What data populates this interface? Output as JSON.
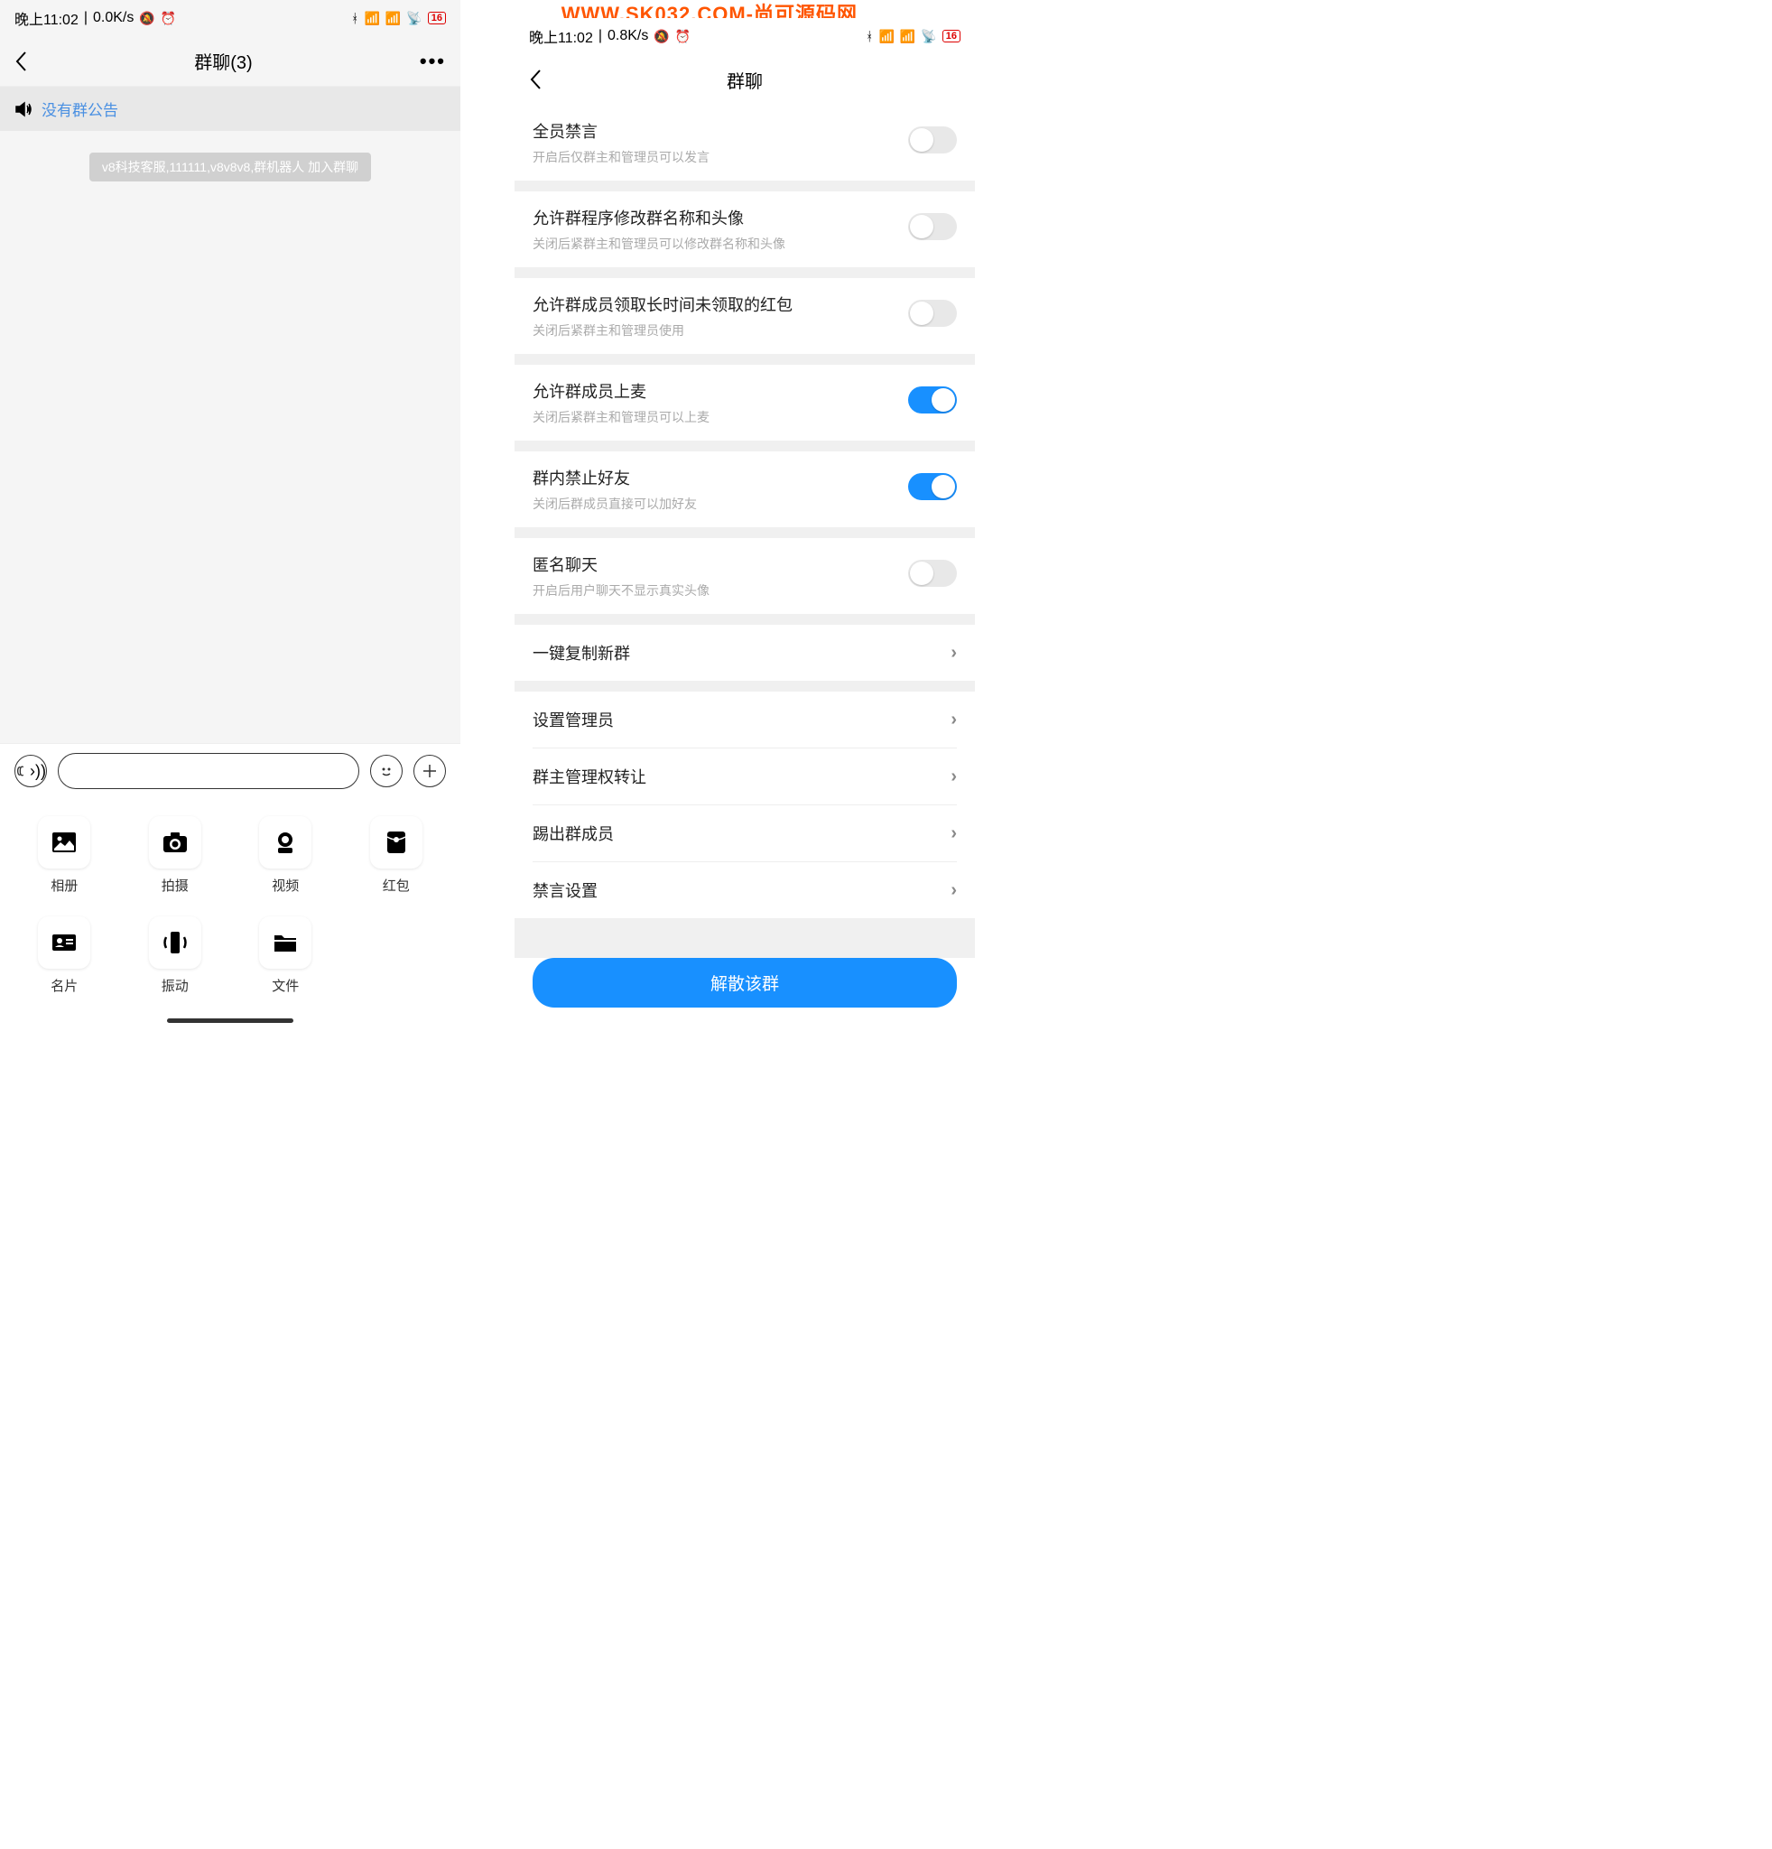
{
  "watermark": "WWW.SK032.COM-尚可源码网",
  "phone1": {
    "status": {
      "time": "晚上11:02",
      "speed": "0.0K/s",
      "battery": "16"
    },
    "header": {
      "title": "群聊(3)"
    },
    "announcement": "没有群公告",
    "system_message": "v8科技客服,111111,v8v8v8,群机器人 加入群聊",
    "attachments": [
      {
        "icon": "image",
        "label": "相册"
      },
      {
        "icon": "camera",
        "label": "拍摄"
      },
      {
        "icon": "video",
        "label": "视频"
      },
      {
        "icon": "redpacket",
        "label": "红包"
      },
      {
        "icon": "card",
        "label": "名片"
      },
      {
        "icon": "vibrate",
        "label": "振动"
      },
      {
        "icon": "folder",
        "label": "文件"
      }
    ]
  },
  "phone2": {
    "status": {
      "time": "晚上11:02",
      "speed": "0.8K/s",
      "battery": "16"
    },
    "header": {
      "title": "群聊"
    },
    "settings": [
      {
        "title": "全员禁言",
        "subtitle": "开启后仅群主和管理员可以发言",
        "toggle": false
      },
      {
        "title": "允许群程序修改群名称和头像",
        "subtitle": "关闭后紧群主和管理员可以修改群名称和头像",
        "toggle": false
      },
      {
        "title": "允许群成员领取长时间未领取的红包",
        "subtitle": "关闭后紧群主和管理员使用",
        "toggle": false
      },
      {
        "title": "允许群成员上麦",
        "subtitle": "关闭后紧群主和管理员可以上麦",
        "toggle": true
      },
      {
        "title": "群内禁止好友",
        "subtitle": "关闭后群成员直接可以加好友",
        "toggle": true
      },
      {
        "title": "匿名聊天",
        "subtitle": "开启后用户聊天不显示真实头像",
        "toggle": false
      }
    ],
    "nav_items": [
      {
        "title": "一键复制新群"
      },
      {
        "title": "设置管理员"
      },
      {
        "title": "群主管理权转让"
      },
      {
        "title": "踢出群成员"
      },
      {
        "title": "禁言设置"
      }
    ],
    "dissolve": "解散该群"
  }
}
